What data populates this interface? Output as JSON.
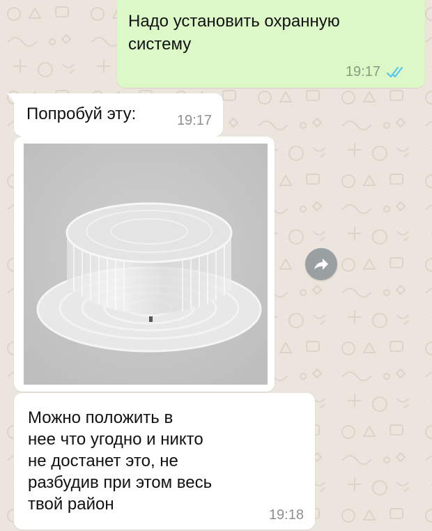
{
  "chat": {
    "messages": [
      {
        "direction": "outgoing",
        "text": "Надо установить охранную\nсистему",
        "time": "19:17",
        "status": "read"
      },
      {
        "direction": "incoming",
        "text": "Попробуй эту:",
        "time": "19:17"
      },
      {
        "direction": "incoming",
        "type": "image",
        "image_subject": "plastic-cake-container"
      },
      {
        "direction": "incoming",
        "text": "Можно положить в\nнее что угодно и никто\nне достанет это, не\nразбудив при этом весь\nтвой район",
        "time": "19:18"
      }
    ],
    "forward_icon": "forward-arrow-icon"
  },
  "colors": {
    "background": "#ece5dd",
    "outgoing_bubble": "#dcf8c6",
    "incoming_bubble": "#ffffff",
    "read_ticks": "#4fc3f7",
    "forward_button": "#9aa0a2"
  }
}
